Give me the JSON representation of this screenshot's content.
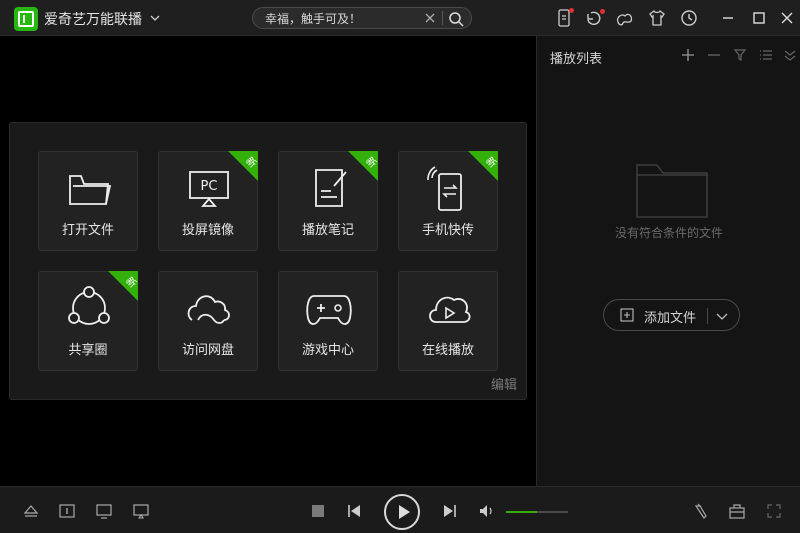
{
  "app": {
    "title": "爱奇艺万能联播"
  },
  "search": {
    "value": "幸福，触手可及！",
    "placeholder": "幸福，触手可及！"
  },
  "tiles": [
    {
      "label": "打开文件",
      "icon": "folder-icon",
      "badge": ""
    },
    {
      "label": "投屏镜像",
      "icon": "pc-cast-icon",
      "badge": "新",
      "icon_text": "PC"
    },
    {
      "label": "播放笔记",
      "icon": "note-icon",
      "badge": "新"
    },
    {
      "label": "手机快传",
      "icon": "phone-transfer-icon",
      "badge": "新"
    },
    {
      "label": "共享圈",
      "icon": "share-circle-icon",
      "badge": "新"
    },
    {
      "label": "访问网盘",
      "icon": "cloud-drive-icon",
      "badge": ""
    },
    {
      "label": "游戏中心",
      "icon": "gamepad-icon",
      "badge": ""
    },
    {
      "label": "在线播放",
      "icon": "cloud-play-icon",
      "badge": ""
    }
  ],
  "panel": {
    "edit_label": "编辑"
  },
  "playlist": {
    "title": "播放列表",
    "empty_text": "没有符合条件的文件",
    "add_file_label": "添加文件"
  },
  "player": {
    "volume_level": 0.5
  },
  "colors": {
    "accent": "#33b10a",
    "notification": "#e53030",
    "background": "#000000"
  }
}
